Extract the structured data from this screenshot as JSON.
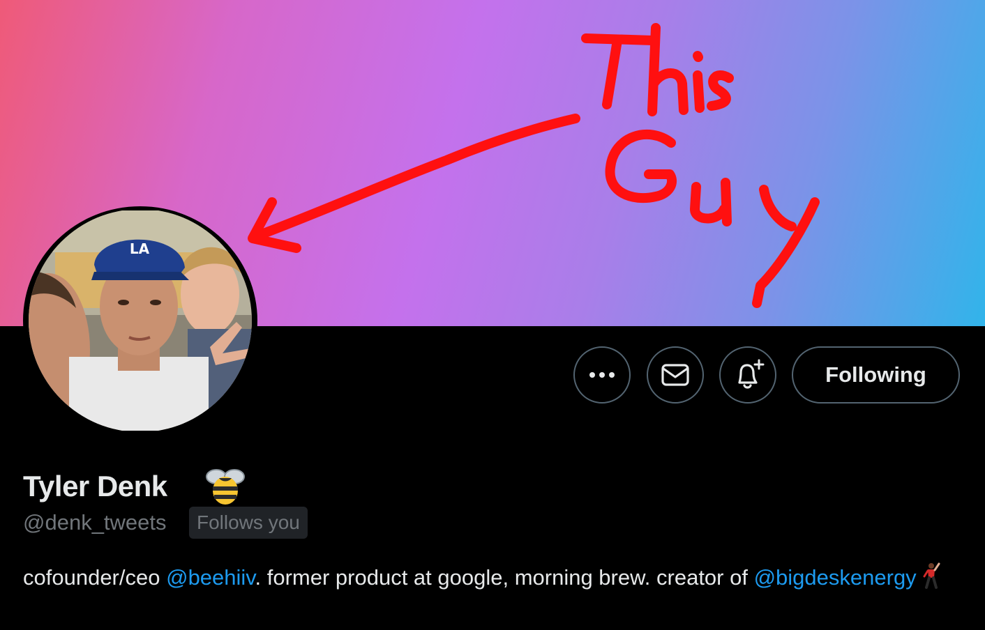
{
  "annotation": {
    "line1": "This",
    "line2": "Guy",
    "color": "#ff1010"
  },
  "actions": {
    "more_icon": "more-horizontal-icon",
    "message_icon": "envelope-icon",
    "notify_icon": "bell-plus-icon",
    "following_label": "Following"
  },
  "profile": {
    "display_name": "Tyler Denk",
    "name_emoji": "bee-icon",
    "handle": "@denk_tweets",
    "follows_you": "Follows you"
  },
  "bio": {
    "part1": "cofounder/ceo ",
    "mention1": "@beehiiv",
    "part2": ". former product at google, morning brew. creator of ",
    "mention2": "@bigdeskenergy",
    "emoji": "dancing-man-icon"
  },
  "colors": {
    "link": "#1d9bf0",
    "text": "#e7e9ea",
    "muted": "#71767b",
    "border": "#536471"
  }
}
